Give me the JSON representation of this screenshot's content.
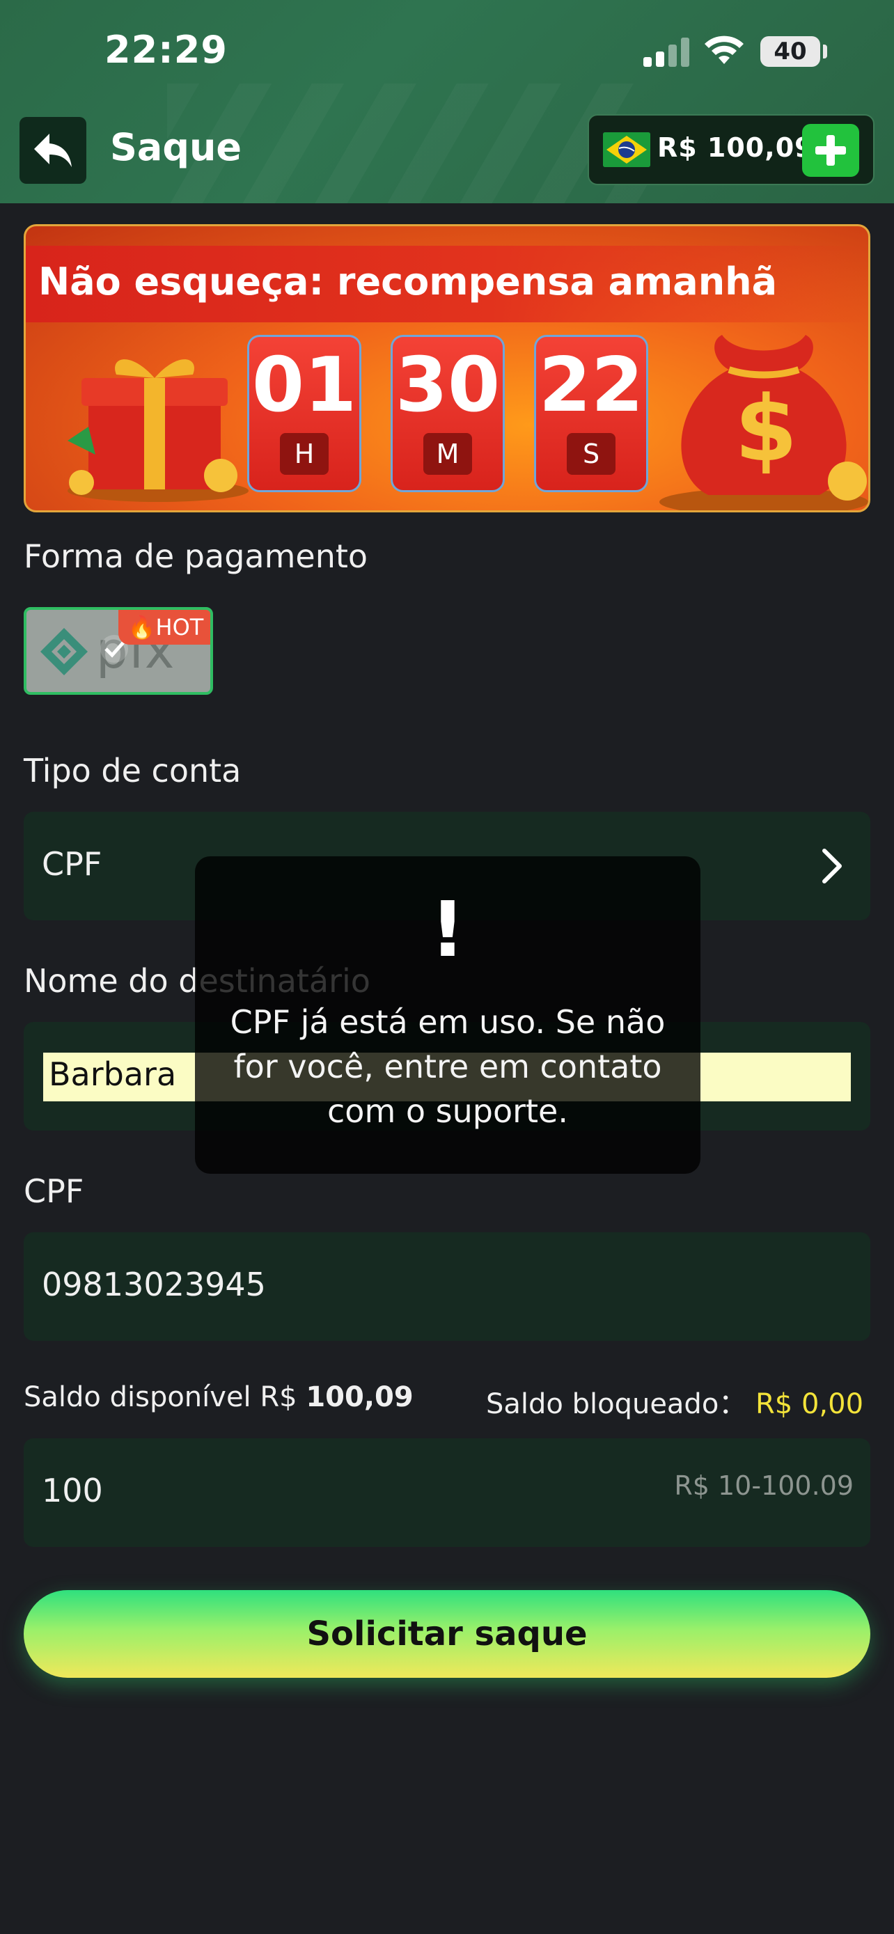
{
  "status_bar": {
    "time": "22:29",
    "battery": "40"
  },
  "header": {
    "title": "Saque",
    "balance": "R$ 100,09",
    "back_icon": "back-arrow-icon",
    "add_icon": "plus-icon",
    "flag_icon": "brazil-flag-icon"
  },
  "banner": {
    "title": "Não esqueça: recompensa amanhã",
    "countdown": [
      {
        "value": "01",
        "unit": "H"
      },
      {
        "value": "30",
        "unit": "M"
      },
      {
        "value": "22",
        "unit": "S"
      }
    ]
  },
  "form": {
    "payment_label": "Forma de pagamento",
    "payment_method": {
      "name": "pix",
      "badge": "HOT"
    },
    "account_type_label": "Tipo de conta",
    "account_type_value": "CPF",
    "recipient_label": "Nome do destinatário",
    "recipient_value": "Barbara",
    "cpf_label": "CPF",
    "cpf_value": "09813023945",
    "available_label": "Saldo disponível R$",
    "available_value": "100,09",
    "blocked_label": "Saldo bloqueado：",
    "blocked_value": "R$ 0,00",
    "amount_value": "100",
    "amount_range": "R$ 10-100.09",
    "submit_label": "Solicitar saque"
  },
  "toast": {
    "icon": "!",
    "message": "CPF já está em uso. Se não for você, entre em contato com o suporte."
  },
  "colors": {
    "header_green": "#2f7450",
    "field_bg": "#162a21",
    "blocked_yellow": "#f3e33a",
    "pix_border": "#2fbd62"
  }
}
